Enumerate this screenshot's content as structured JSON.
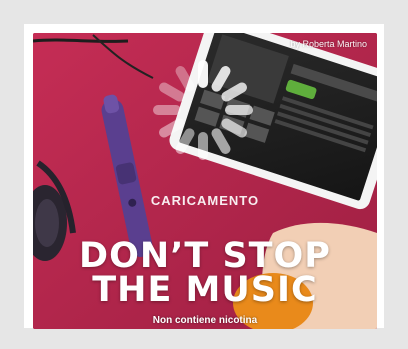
{
  "ad": {
    "author": "by Roberta Martino",
    "loading_label": "CARICAMENTO",
    "headline_line1": "DON’T STOP",
    "headline_line2": "THE MUSIC",
    "tagline": "Non contiene nicotina"
  },
  "icons": [
    "loading-spinner-icon"
  ],
  "colors": {
    "page_bg": "#e6e6e6",
    "card_bg": "#b8264d",
    "text": "#ffffff",
    "vape_pen": "#5a3f8f"
  }
}
